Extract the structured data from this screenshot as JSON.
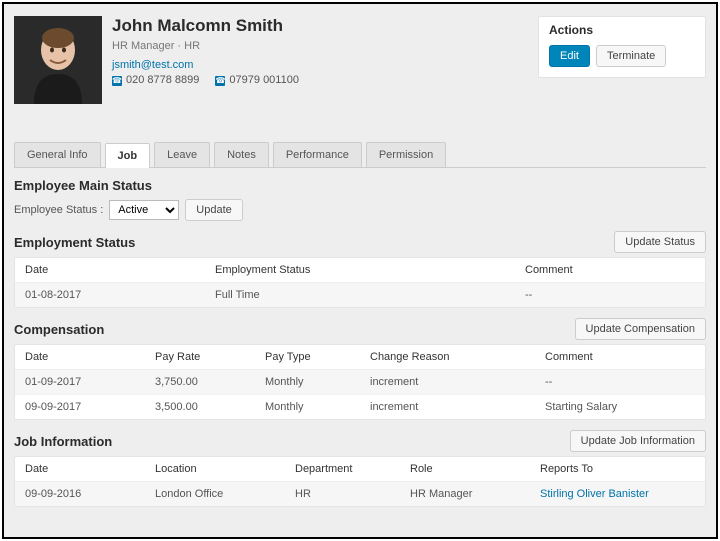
{
  "employee": {
    "name": "John Malcomn Smith",
    "role_line": "HR Manager · HR",
    "email": "jsmith@test.com",
    "phone_office": "020 8778 8899",
    "phone_mobile": "07979 001100"
  },
  "actions": {
    "title": "Actions",
    "edit": "Edit",
    "terminate": "Terminate"
  },
  "tabs": [
    {
      "label": "General Info",
      "active": false
    },
    {
      "label": "Job",
      "active": true
    },
    {
      "label": "Leave",
      "active": false
    },
    {
      "label": "Notes",
      "active": false
    },
    {
      "label": "Performance",
      "active": false
    },
    {
      "label": "Permission",
      "active": false
    }
  ],
  "main_status": {
    "title": "Employee Main Status",
    "label": "Employee Status :",
    "selected": "Active",
    "update_btn": "Update"
  },
  "employment_status": {
    "title": "Employment Status",
    "update_btn": "Update Status",
    "cols": [
      "Date",
      "Employment Status",
      "Comment"
    ],
    "rows": [
      {
        "date": "01-08-2017",
        "status": "Full Time",
        "comment": "--"
      }
    ]
  },
  "compensation": {
    "title": "Compensation",
    "update_btn": "Update Compensation",
    "cols": [
      "Date",
      "Pay Rate",
      "Pay Type",
      "Change Reason",
      "Comment"
    ],
    "rows": [
      {
        "date": "01-09-2017",
        "rate": "3,750.00",
        "type": "Monthly",
        "reason": "increment",
        "comment": "--"
      },
      {
        "date": "09-09-2017",
        "rate": "3,500.00",
        "type": "Monthly",
        "reason": "increment",
        "comment": "Starting Salary"
      }
    ]
  },
  "job_info": {
    "title": "Job Information",
    "update_btn": "Update Job Information",
    "cols": [
      "Date",
      "Location",
      "Department",
      "Role",
      "Reports To"
    ],
    "rows": [
      {
        "date": "09-09-2016",
        "location": "London Office",
        "department": "HR",
        "role": "HR Manager",
        "reports_to": "Stirling Oliver Banister"
      }
    ]
  }
}
